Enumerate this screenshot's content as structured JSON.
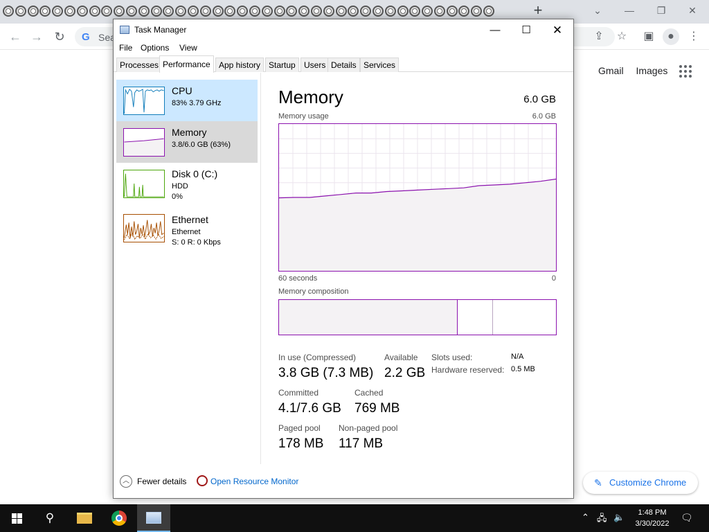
{
  "chrome": {
    "omnibox_text": "Sea",
    "ntp_links": [
      "Gmail",
      "Images"
    ],
    "customize_label": "Customize Chrome"
  },
  "taskmgr": {
    "title": "Task Manager",
    "menu": [
      "File",
      "Options",
      "View"
    ],
    "tabs": [
      "Processes",
      "Performance",
      "App history",
      "Startup",
      "Users",
      "Details",
      "Services"
    ],
    "active_tab": "Performance",
    "sidebar": [
      {
        "name": "CPU",
        "line1": "83%  3.79 GHz",
        "line2": "",
        "color": "#117dbb"
      },
      {
        "name": "Memory",
        "line1": "3.8/6.0 GB (63%)",
        "line2": "",
        "color": "#8b12ae"
      },
      {
        "name": "Disk 0 (C:)",
        "line1": "HDD",
        "line2": "0%",
        "color": "#4da60c"
      },
      {
        "name": "Ethernet",
        "line1": "Ethernet",
        "line2": "S: 0  R: 0 Kbps",
        "color": "#a74f01"
      }
    ],
    "memory": {
      "heading": "Memory",
      "total": "6.0 GB",
      "usage_label": "Memory usage",
      "usage_max": "6.0 GB",
      "time_left": "60 seconds",
      "time_right": "0",
      "composition_label": "Memory composition",
      "stats": {
        "in_use_label": "In use (Compressed)",
        "in_use_value": "3.8 GB (7.3 MB)",
        "available_label": "Available",
        "available_value": "2.2 GB",
        "slots_label": "Slots used:",
        "slots_value": "N/A",
        "hw_reserved_label": "Hardware reserved:",
        "hw_reserved_value": "0.5 MB",
        "committed_label": "Committed",
        "committed_value": "4.1/7.6 GB",
        "cached_label": "Cached",
        "cached_value": "769 MB",
        "paged_label": "Paged pool",
        "paged_value": "178 MB",
        "nonpaged_label": "Non-paged pool",
        "nonpaged_value": "117 MB"
      },
      "usage_series_pct": [
        0.497,
        0.5,
        0.5,
        0.51,
        0.52,
        0.53,
        0.53,
        0.54,
        0.545,
        0.55,
        0.555,
        0.56,
        0.565,
        0.58,
        0.585,
        0.59,
        0.6,
        0.61,
        0.625
      ]
    },
    "footer": {
      "fewer_details": "Fewer details",
      "open_resmon": "Open Resource Monitor"
    }
  },
  "taskbar": {
    "time": "1:48 PM",
    "date": "3/30/2022"
  }
}
